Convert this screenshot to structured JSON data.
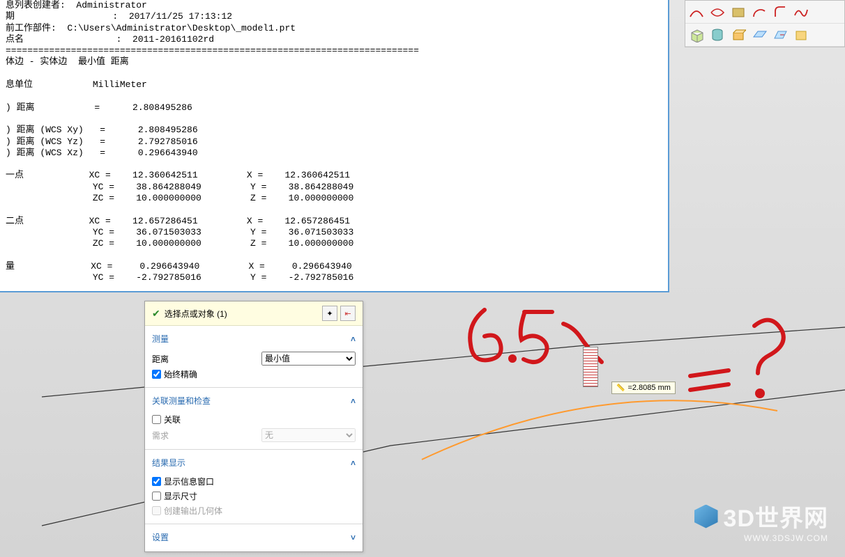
{
  "info": {
    "lines": [
      "息列表创建者:  Administrator",
      "期                  :  2017/11/25 17:13:12",
      "前工作部件:  C:\\Users\\Administrator\\Desktop\\_model1.prt",
      "点名                 :  2011-20161102rd",
      "============================================================================",
      "体边 - 实体边  最小值 距离",
      "",
      "息单位           MilliMeter",
      "",
      ") 距离           =      2.808495286",
      "",
      ") 距离 (WCS Xy)   =      2.808495286",
      ") 距离 (WCS Yz)   =      2.792785016",
      ") 距离 (WCS Xz)   =      0.296643940",
      "",
      "一点            XC =    12.360642511         X =    12.360642511",
      "                YC =    38.864288049         Y =    38.864288049",
      "                ZC =    10.000000000         Z =    10.000000000",
      "",
      "二点            XC =    12.657286451         X =    12.657286451",
      "                YC =    36.071503033         Y =    36.071503033",
      "                ZC =    10.000000000         Z =    10.000000000",
      "",
      "量              XC =     0.296643940         X =     0.296643940",
      "                YC =    -2.792785016         Y =    -2.792785016"
    ]
  },
  "dialog": {
    "select": {
      "text": "选择点或对象 (1)"
    },
    "section_measure": "测量",
    "distance_label": "距离",
    "distance_mode": "最小值",
    "always_exact": "始终精确",
    "section_assoc": "关联测量和检查",
    "assoc_label": "关联",
    "req_label": "需求",
    "req_value": "无",
    "section_result": "结果显示",
    "show_info_win": "显示信息窗口",
    "show_dim": "显示尺寸",
    "create_geom": "创建输出几何体",
    "section_settings": "设置"
  },
  "dim": {
    "value": "=2.8085 mm"
  },
  "logo": {
    "title": "3D世界网",
    "url": "WWW.3DSJW.COM"
  }
}
